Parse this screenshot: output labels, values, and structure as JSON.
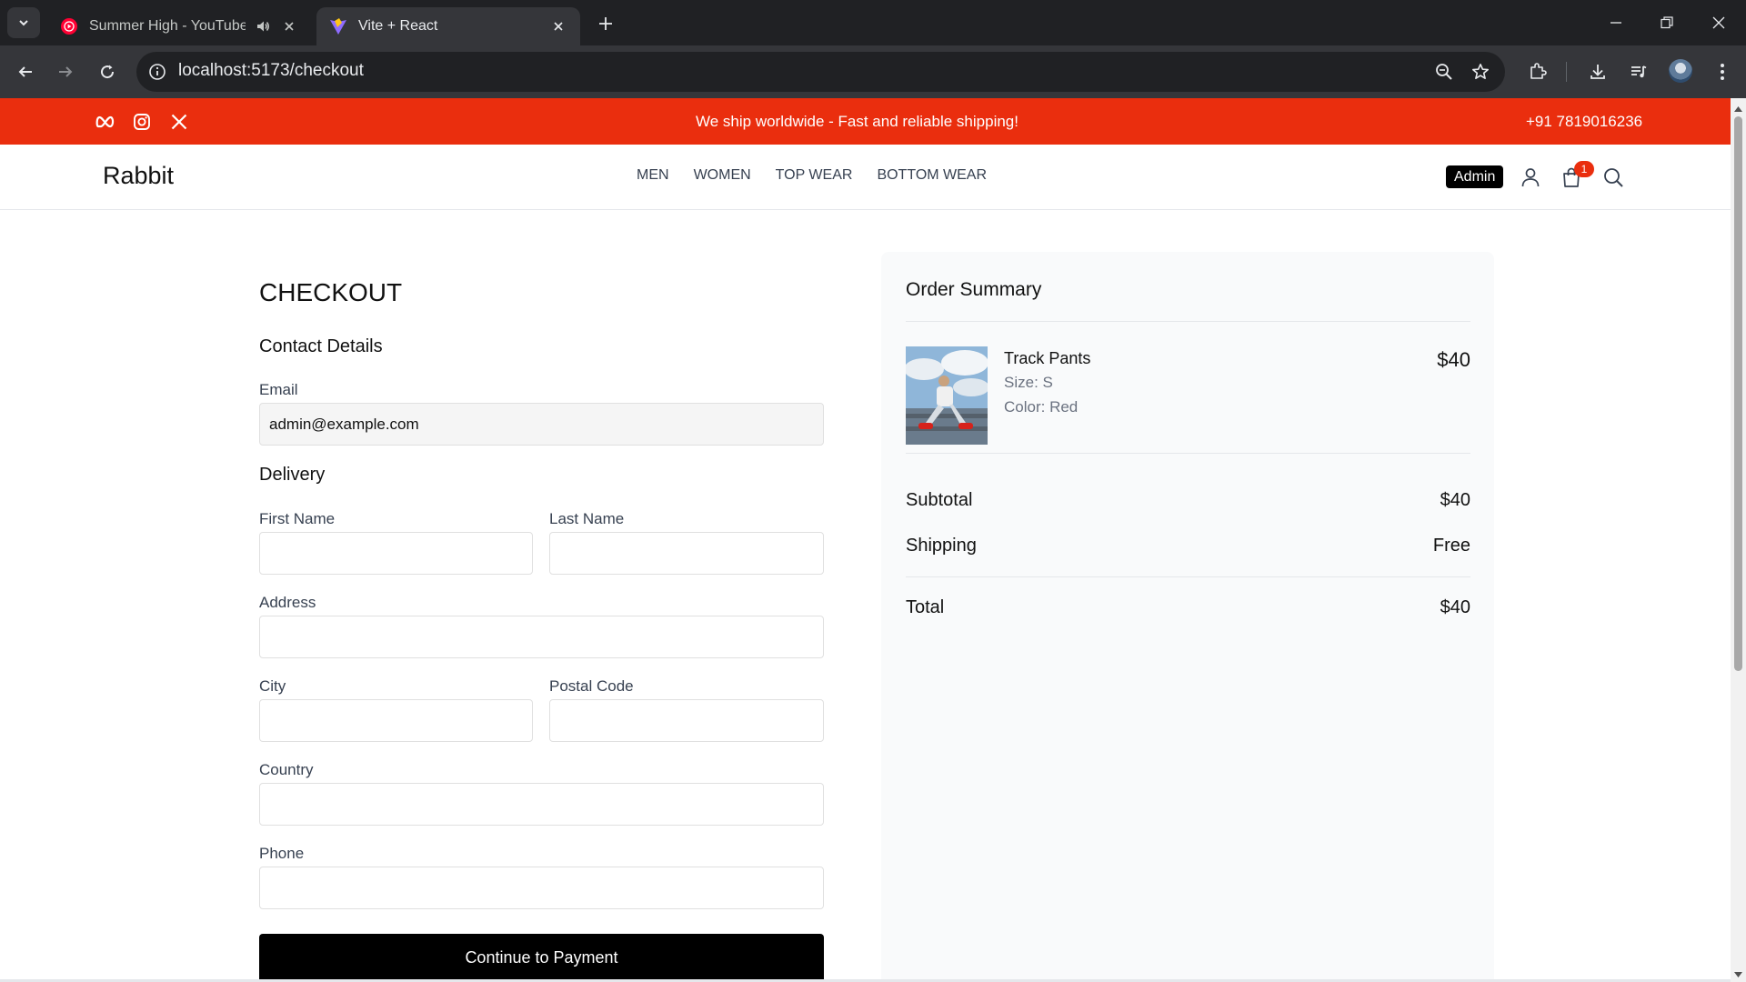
{
  "browser": {
    "tabs": [
      {
        "title": "Summer High - YouTube Mu",
        "icon": "youtube-music-icon",
        "active": false
      },
      {
        "title": "Vite + React",
        "icon": "vite-icon",
        "active": true
      }
    ],
    "url": "localhost:5173/checkout",
    "colors": {
      "tabbar": "#202124",
      "toolbar": "#35363a"
    }
  },
  "announcement": {
    "text": "We ship worldwide - Fast and reliable shipping!",
    "phone": "+91 7819016236",
    "social_icons": [
      "meta-icon",
      "instagram-icon",
      "x-twitter-icon"
    ],
    "color": "#ea2e0e"
  },
  "navbar": {
    "logo": "Rabbit",
    "links": [
      "MEN",
      "WOMEN",
      "TOP WEAR",
      "BOTTOM WEAR"
    ],
    "admin_label": "Admin",
    "cart_count": "1"
  },
  "checkout": {
    "title": "CHECKOUT",
    "contact_heading": "Contact Details",
    "email_label": "Email",
    "email_value": "admin@example.com",
    "delivery_heading": "Delivery",
    "first_name_label": "First Name",
    "last_name_label": "Last Name",
    "address_label": "Address",
    "city_label": "City",
    "postal_code_label": "Postal Code",
    "country_label": "Country",
    "phone_label": "Phone",
    "continue_label": "Continue to Payment"
  },
  "summary": {
    "title": "Order Summary",
    "product": {
      "name": "Track Pants",
      "size": "Size: S",
      "color": "Color: Red",
      "price": "$40"
    },
    "subtotal_label": "Subtotal",
    "subtotal_value": "$40",
    "shipping_label": "Shipping",
    "shipping_value": "Free",
    "total_label": "Total",
    "total_value": "$40"
  }
}
